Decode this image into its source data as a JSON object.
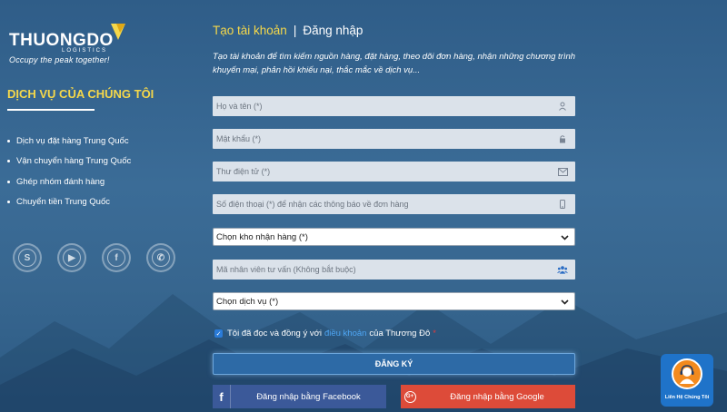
{
  "brand": {
    "name": "THUONGDO",
    "sub": "LOGISTICS",
    "tagline": "Occupy the peak together!"
  },
  "sidebar": {
    "title": "DỊCH VỤ CỦA CHÚNG TÔI",
    "items": [
      "Dịch vụ đặt hàng Trung Quốc",
      "Vận chuyển hàng Trung Quốc",
      "Ghép nhóm đánh hàng",
      "Chuyển tiền Trung Quốc"
    ],
    "socials": [
      {
        "icon": "skype-icon",
        "glyph": "S"
      },
      {
        "icon": "youtube-icon",
        "glyph": "▶"
      },
      {
        "icon": "facebook-icon",
        "glyph": "f"
      },
      {
        "icon": "whatsapp-icon",
        "glyph": "✆"
      }
    ]
  },
  "tabs": {
    "register": "Tạo tài khoản",
    "separator": "|",
    "login": "Đăng nhập"
  },
  "intro": "Tạo tài khoản để tìm kiếm nguồn hàng, đặt hàng, theo dõi đơn hàng, nhận những chương trình khuyến mại, phản hồi khiếu nại, thắc mắc về dịch vụ...",
  "form": {
    "fullname_placeholder": "Họ và tên (*)",
    "password_placeholder": "Mật khẩu (*)",
    "email_placeholder": "Thư điện tử (*)",
    "phone_placeholder": "Số điện thoại (*) để nhận các thông báo về đơn hàng",
    "warehouse_selected": "Chọn kho nhận hàng (*)",
    "advisor_placeholder": "Mã nhân viên tư vấn (Không bắt buộc)",
    "service_selected": "Chọn dịch vụ (*)",
    "agree_prefix": "Tôi đã đọc và đồng ý với",
    "agree_link": "điều khoản",
    "agree_suffix": "của Thương Đô",
    "required_mark": "*",
    "submit": "ĐĂNG KÝ",
    "facebook_login": "Đăng nhập bằng Facebook",
    "google_login": "Đăng nhập bằng Google"
  },
  "contact": {
    "label": "Liên Hệ Chúng Tôi"
  },
  "colors": {
    "accent_yellow": "#f5d84a",
    "facebook": "#3b5999",
    "google": "#dd4b39",
    "submit": "#2d6aa6",
    "contact": "#1f73c9"
  }
}
